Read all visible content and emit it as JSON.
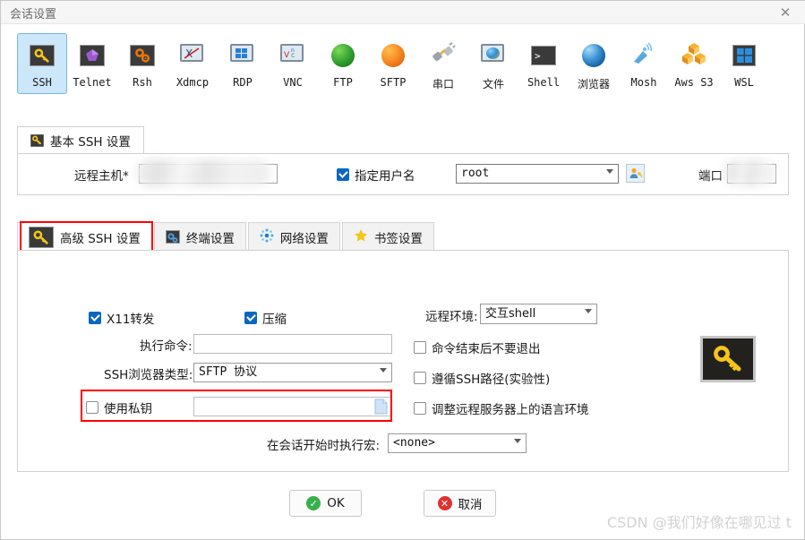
{
  "window": {
    "title": "会话设置",
    "close_label": "✕"
  },
  "session_types": [
    {
      "label": "SSH",
      "icon": "key-icon",
      "selected": true
    },
    {
      "label": "Telnet",
      "icon": "telnet-icon",
      "selected": false
    },
    {
      "label": "Rsh",
      "icon": "rsh-gears-icon",
      "selected": false
    },
    {
      "label": "Xdmcp",
      "icon": "xdmcp-monitor-icon",
      "selected": false
    },
    {
      "label": "RDP",
      "icon": "rdp-monitor-icon",
      "selected": false
    },
    {
      "label": "VNC",
      "icon": "vnc-monitor-icon",
      "selected": false
    },
    {
      "label": "FTP",
      "icon": "ftp-globe-icon",
      "selected": false
    },
    {
      "label": "SFTP",
      "icon": "sftp-globe-icon",
      "selected": false
    },
    {
      "label": "串口",
      "icon": "serial-plug-icon",
      "selected": false
    },
    {
      "label": "文件",
      "icon": "file-monitor-icon",
      "selected": false
    },
    {
      "label": "Shell",
      "icon": "shell-console-icon",
      "selected": false
    },
    {
      "label": "浏览器",
      "icon": "browser-globe-icon",
      "selected": false
    },
    {
      "label": "Mosh",
      "icon": "mosh-satellite-icon",
      "selected": false
    },
    {
      "label": "Aws S3",
      "icon": "aws-s3-cubes-icon",
      "selected": false
    },
    {
      "label": "WSL",
      "icon": "wsl-windows-icon",
      "selected": false
    }
  ],
  "basic": {
    "tab_label": "基本 SSH 设置",
    "tab_icon": "key-icon",
    "remote_host_label": "远程主机*",
    "remote_host_value": "",
    "specify_username_label": "指定用户名",
    "specify_username_checked": true,
    "username_value": "root",
    "username_icon": "user-key-icon",
    "port_label": "端口",
    "port_value": ""
  },
  "adv_tabs": [
    {
      "label": "高级 SSH 设置",
      "icon": "key-icon",
      "active": true
    },
    {
      "label": "终端设置",
      "icon": "terminal-gear-icon",
      "active": false
    },
    {
      "label": "网络设置",
      "icon": "network-dots-icon",
      "active": false
    },
    {
      "label": "书签设置",
      "icon": "star-icon",
      "active": false
    }
  ],
  "advanced": {
    "x11_label": "X11转发",
    "x11_checked": true,
    "compression_label": "压缩",
    "compression_checked": true,
    "exec_command_label": "执行命令:",
    "exec_command_value": "",
    "ssh_browser_label": "SSH浏览器类型:",
    "ssh_browser_value": "SFTP 协议",
    "use_private_key_label": "使用私钥",
    "use_private_key_checked": false,
    "private_key_value": "",
    "private_key_browse_icon": "file-browse-icon",
    "remote_env_label": "远程环境:",
    "remote_env_value": "交互shell",
    "no_exit_label": "命令结束后不要退出",
    "no_exit_checked": false,
    "follow_ssh_path_label": "遵循SSH路径(实验性)",
    "follow_ssh_path_checked": false,
    "adjust_locale_label": "调整远程服务器上的语言环境",
    "adjust_locale_checked": false,
    "macro_label": "在会话开始时执行宏:",
    "macro_value": "<none>",
    "key_badge_icon": "key-icon"
  },
  "footer": {
    "ok_label": "OK",
    "ok_icon": "check-circle-icon",
    "cancel_label": "取消",
    "cancel_icon": "x-circle-icon"
  },
  "watermark": "CSDN @我们好像在哪见过 t",
  "colors": {
    "accent": "#0a66c2",
    "selected_bg": "#cce6fa",
    "highlight": "#ff0000",
    "ok_green": "#36b14a",
    "cancel_red": "#e03131",
    "key_yellow": "#f5c518"
  }
}
